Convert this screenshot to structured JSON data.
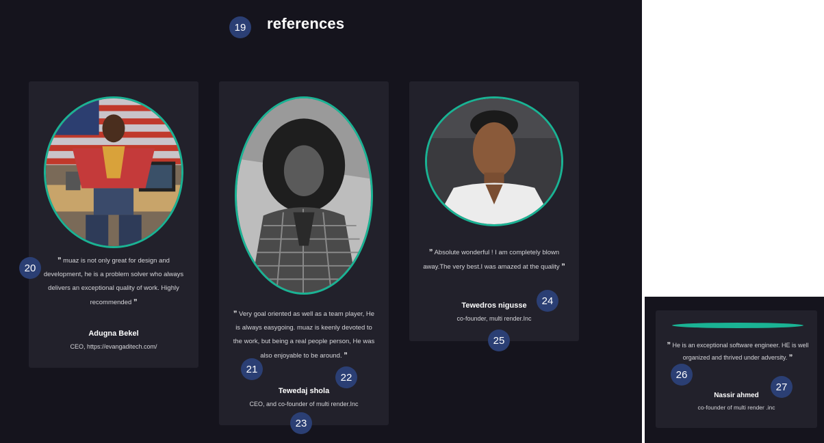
{
  "section": {
    "title": "references"
  },
  "badges": [
    "19",
    "20",
    "21",
    "22",
    "23",
    "24",
    "25",
    "26",
    "27"
  ],
  "colors": {
    "accent": "#1ab394",
    "background": "#15141d",
    "card": "#22212b",
    "badge": "#2b3f74"
  },
  "references": [
    {
      "quote": "muaz is not only great for design and development, he is a problem solver who always delivers an exceptional quality of work. Highly recommended",
      "name": "Adugna Bekel",
      "title": "CEO, https://evangaditech.com/",
      "photo": "man-with-flag-photo"
    },
    {
      "quote": "Very goal oriented as well as a team player, He is always easygoing. muaz is keenly devoted to the work, but being a real people person, He was also enjoyable to be around.",
      "name": "Tewedaj shola",
      "title": "CEO, and co-founder of multi render.Inc",
      "photo": "woman-portrait-photo"
    },
    {
      "quote": "Absolute wonderful ! I am completely blown away.The very best.I was amazed at the quality",
      "name": "Tewedros nigusse",
      "title": "co-founder, multi render.Inc",
      "photo": "man-portrait-photo"
    },
    {
      "quote": "He is an exceptional software engineer. HE is well organized and thrived under adversity.",
      "name": "Nassir ahmed",
      "title": "co-founder of multi render .inc",
      "photo": "teal-divider"
    }
  ],
  "quote_open": "”",
  "quote_close": "”"
}
